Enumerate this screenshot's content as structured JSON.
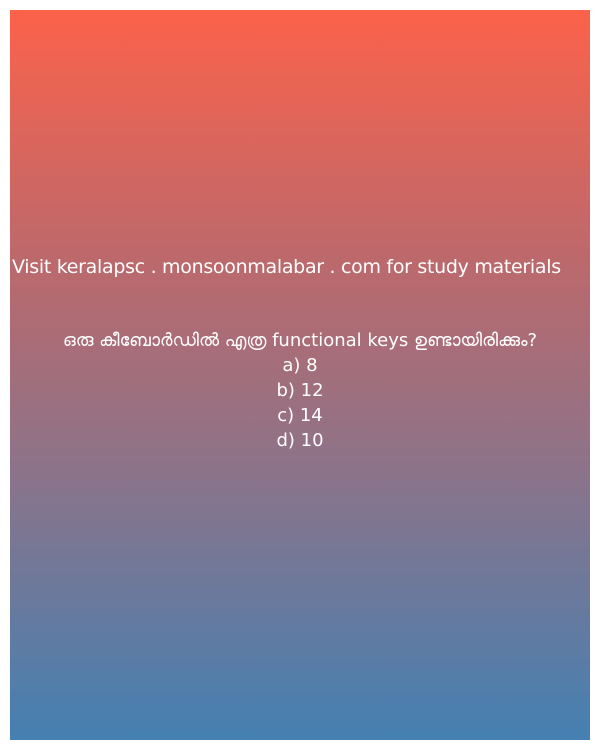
{
  "promo_text": "Visit keralapsc . monsoonmalabar . com for study materials",
  "question": "ഒരു കീബോർഡിൽ എത്ര functional keys ഉണ്ടായിരിക്കും?",
  "options": [
    "a) 8",
    "b) 12",
    "c) 14",
    "d) 10"
  ],
  "colors": {
    "gradient_top": "#fc624a",
    "gradient_bottom": "#4480b2",
    "text": "#ffffff"
  }
}
